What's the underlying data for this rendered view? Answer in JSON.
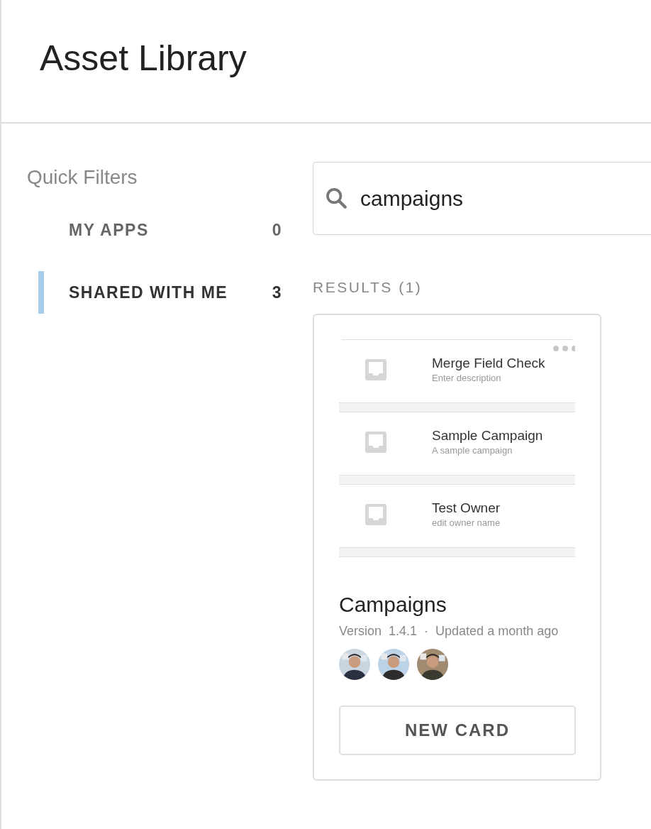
{
  "header": {
    "title": "Asset Library"
  },
  "sidebar": {
    "title": "Quick Filters",
    "items": [
      {
        "label": "MY APPS",
        "count": "0",
        "selected": false
      },
      {
        "label": "SHARED WITH ME",
        "count": "3",
        "selected": true
      }
    ]
  },
  "search": {
    "value": "campaigns"
  },
  "results": {
    "label": "RESULTS (1)",
    "cards": [
      {
        "preview": {
          "rows": [
            {
              "title": "Merge Field Check",
              "description": "Enter description"
            },
            {
              "title": "Sample Campaign",
              "description": "A sample campaign"
            },
            {
              "title": "Test Owner",
              "description": "edit owner name"
            }
          ]
        },
        "title": "Campaigns",
        "meta": "Version  1.4.1  ·  Updated a month ago",
        "button": "NEW CARD"
      }
    ]
  }
}
